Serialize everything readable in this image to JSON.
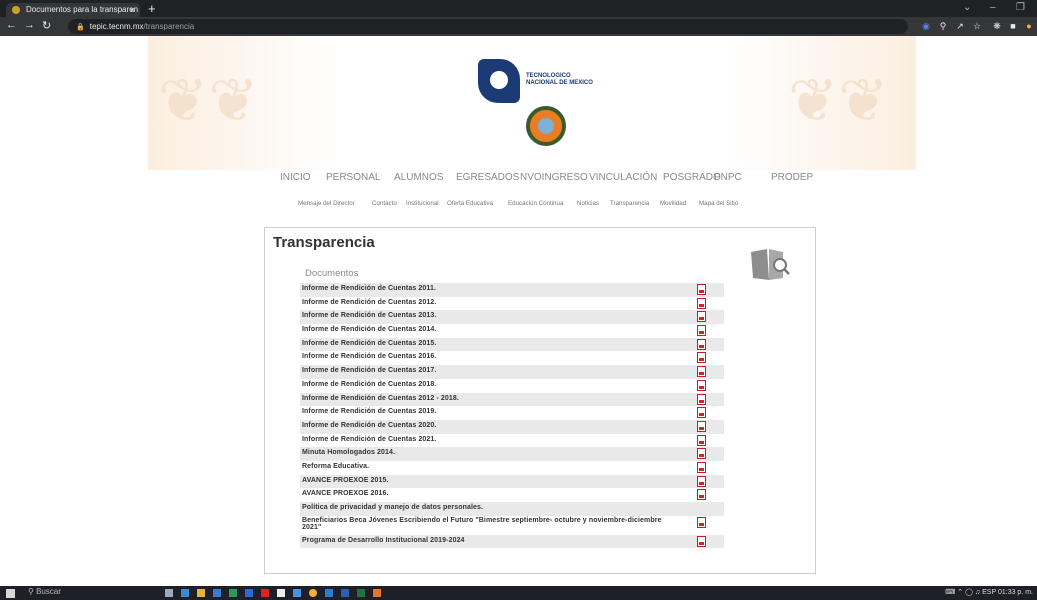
{
  "browser": {
    "tab_title": "Documentos para la transparen",
    "tab_close": "×",
    "new_tab": "+",
    "url_host": "tepic.tecnm.mx",
    "url_path": "/transparencia"
  },
  "header": {
    "logo_text_line1": "TECNOLOGICO",
    "logo_text_line2": "NACIONAL DE MEXICO"
  },
  "main_nav": [
    "INICIO",
    "PERSONAL",
    "ALUMNOS",
    "EGRESADOS",
    "NVOINGRESO",
    "VINCULACIÓN",
    "POSGRADO",
    "PNPC",
    "PRODEP"
  ],
  "sub_nav": [
    "Mensaje del Director",
    "Contacto",
    "Institucional",
    "Oferta Educativa",
    "Educación Continua",
    "Noticias",
    "Transparencia",
    "Movilidad",
    "Mapa del Sitio"
  ],
  "content": {
    "title": "Transparencia",
    "section": "Documentos",
    "documents": [
      {
        "label": "Informe de Rendición de Cuentas 2011.",
        "pdf": true
      },
      {
        "label": "Informe de Rendición de Cuentas 2012.",
        "pdf": true
      },
      {
        "label": "Informe de Rendición de Cuentas 2013.",
        "pdf": true
      },
      {
        "label": "Informe de Rendición de Cuentas 2014.",
        "pdf": true
      },
      {
        "label": "Informe de Rendición de Cuentas 2015.",
        "pdf": true
      },
      {
        "label": "Informe de Rendición de Cuentas 2016.",
        "pdf": true
      },
      {
        "label": "Informe de Rendición de Cuentas 2017.",
        "pdf": true
      },
      {
        "label": "Informe de Rendición de Cuentas 2018.",
        "pdf": true
      },
      {
        "label": "Informe de Rendición de Cuentas 2012 - 2018.",
        "pdf": true
      },
      {
        "label": "Informe de Rendición de Cuentas 2019.",
        "pdf": true
      },
      {
        "label": "Informe de Rendición de Cuentas 2020.",
        "pdf": true
      },
      {
        "label": "Informe de Rendición de Cuentas 2021.",
        "pdf": true
      },
      {
        "label": "Minuta Homologados 2014.",
        "pdf": true
      },
      {
        "label": "Reforma Educativa.",
        "pdf": true
      },
      {
        "label": "AVANCE PROEXOE 2015.",
        "pdf": true
      },
      {
        "label": "AVANCE PROEXOE 2016.",
        "pdf": true
      },
      {
        "label": "Política de privacidad y manejo de datos personales.",
        "pdf": false
      },
      {
        "label": "Beneficiarios Beca Jóvenes Escribiendo el Futuro \"Bimestre septiembre- octubre y noviembre-diciembre 2021\"",
        "pdf": true
      },
      {
        "label": "Programa de Desarrollo Institucional 2019-2024",
        "pdf": true
      }
    ]
  },
  "taskbar": {
    "search_label": "Buscar",
    "language": "ESP",
    "clock": "01:33 p. m."
  }
}
